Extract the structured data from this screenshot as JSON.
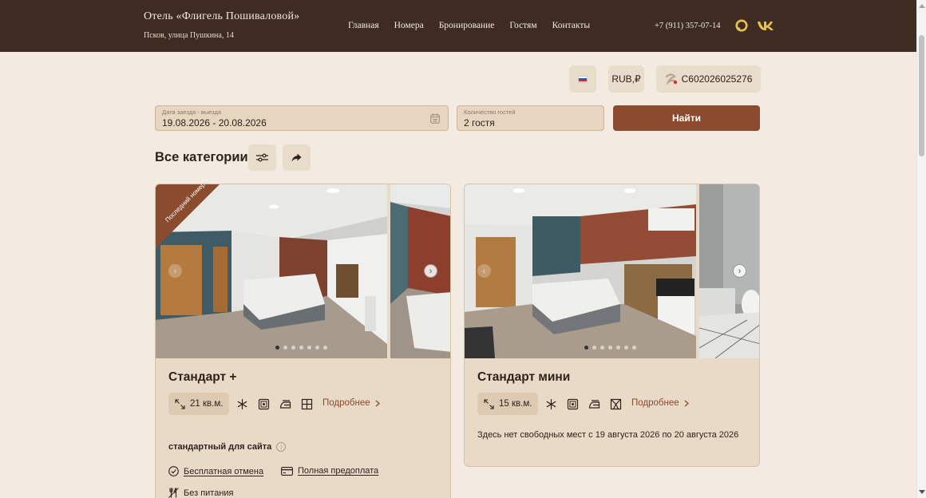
{
  "header": {
    "hotel_name": "Отель «Флигель Пошиваловой»",
    "address": "Псков, улица Пушкина, 14",
    "nav": [
      "Главная",
      "Номера",
      "Бронирование",
      "Гостям",
      "Контакты"
    ],
    "phone": "+7 (911) 357-07-14",
    "social_icons": [
      "max-icon",
      "vk-icon"
    ]
  },
  "toolbar": {
    "language_flag": "russia-flag-icon",
    "currency": "RUB,₽",
    "account_id": "C602026025276"
  },
  "search": {
    "dates_label": "Дата заезда - выезда",
    "dates_value": "19.08.2026 - 20.08.2026",
    "guests_label": "Количество гостей",
    "guests_value": "2 гостя",
    "submit_label": "Найти"
  },
  "category": {
    "title": "Все категории"
  },
  "rooms": [
    {
      "badge": "Последний номер",
      "title": "Стандарт +",
      "area": "21 кв.м.",
      "amenities": [
        "snowflake-icon",
        "safe-icon",
        "iron-icon",
        "window-icon"
      ],
      "more_label": "Подробнее",
      "tariff_name": "стандартный для сайта",
      "options": [
        "Бесплатная отмена",
        "Полная предоплата",
        "Без питания"
      ],
      "gallery_dots": 7,
      "gallery_active": 1
    },
    {
      "title": "Стандарт мини",
      "area": "15 кв.м.",
      "amenities": [
        "snowflake-icon",
        "safe-icon",
        "iron-icon",
        "hanger-icon"
      ],
      "more_label": "Подробнее",
      "unavailable_text": "Здесь нет свободных мест с 19 августа 2026 по 20 августа 2026",
      "gallery_dots": 7,
      "gallery_active": 1
    }
  ],
  "colors": {
    "header_bg": "#3e2b22",
    "page_bg": "#f3ebe1",
    "accent": "#8a4b2e",
    "card_bg": "#e8dac6"
  }
}
